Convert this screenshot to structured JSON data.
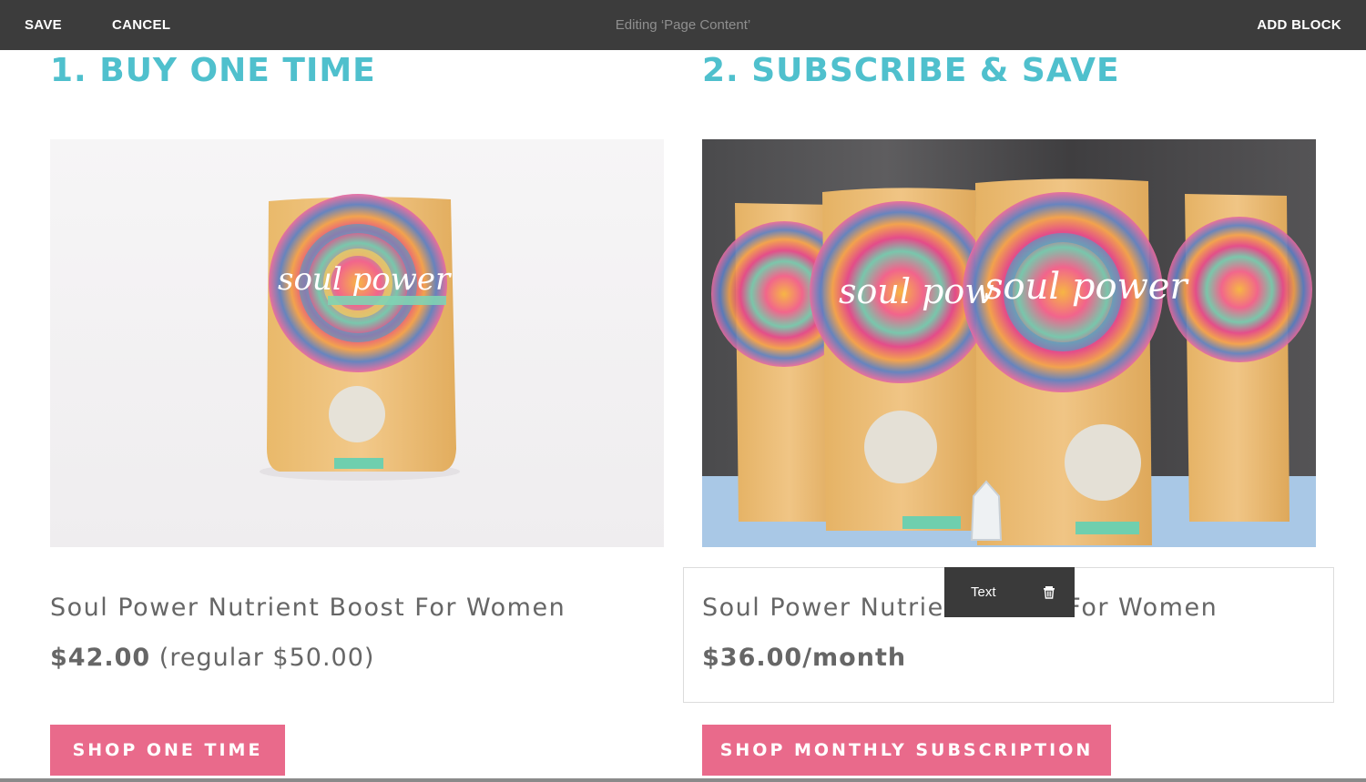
{
  "editor_bar": {
    "save_label": "SAVE",
    "cancel_label": "CANCEL",
    "title": "Editing ‘Page Content’",
    "add_block_label": "ADD BLOCK"
  },
  "colors": {
    "heading": "#4fc0cd",
    "button": "#e96a8b",
    "body_text": "#666666",
    "editor_bar": "#3c3c3c"
  },
  "left_column": {
    "heading": "1. BUY ONE TIME",
    "image_icon": "product-photo-single-bag",
    "product_name": "Soul Power Nutrient Boost For Women",
    "price": "$42.00",
    "price_note": " (regular $50.00)",
    "button_label": "SHOP ONE TIME"
  },
  "right_column": {
    "heading": "2. SUBSCRIBE & SAVE",
    "image_icon": "product-photo-multiple-bags",
    "product_name": "Soul Power Nutrient Boost For Women",
    "price": "$36.00/month",
    "button_label": "SHOP MONTHLY SUBSCRIPTION"
  },
  "block_toolbar": {
    "label": "Text",
    "delete_icon": "trash-icon"
  }
}
